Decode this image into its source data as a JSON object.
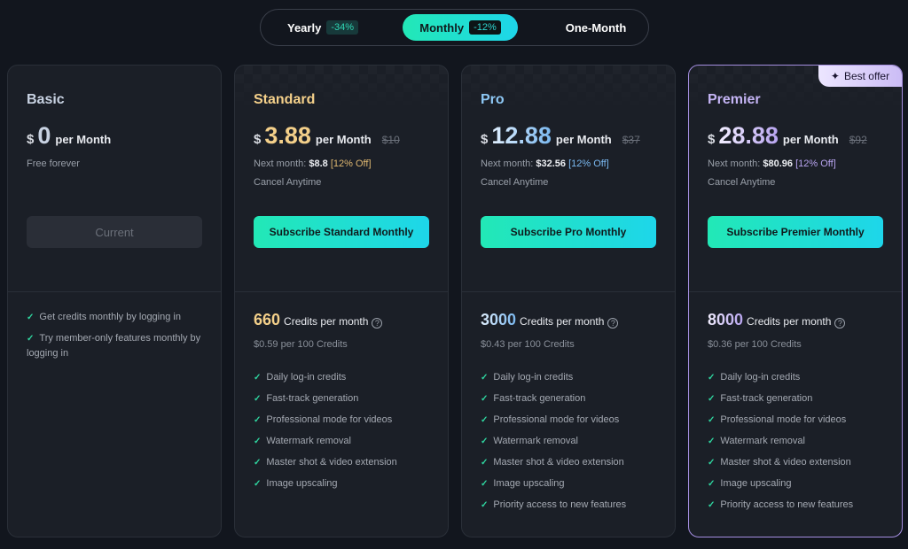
{
  "billing_toggle": {
    "options": [
      {
        "label": "Yearly",
        "badge": "-34%"
      },
      {
        "label": "Monthly",
        "badge": "-12%"
      },
      {
        "label": "One-Month",
        "badge": null
      }
    ],
    "selected": "Monthly"
  },
  "colors": {
    "accent_gradient_start": "#22e8b6",
    "accent_gradient_end": "#1ed6ea",
    "basic": "#c8d2e2",
    "standard": "#f4d08a",
    "pro": "#8ec8f5",
    "premier": "#c4b4f4"
  },
  "plans": [
    {
      "name": "Basic",
      "currency": "$",
      "amount": "0",
      "per": "per Month",
      "note": "Free forever",
      "button": "Current",
      "features": [
        "Get credits monthly by logging in",
        "Try member-only features monthly by logging in"
      ]
    },
    {
      "name": "Standard",
      "currency": "$",
      "amount": "3.88",
      "per": "per Month",
      "original": "$10",
      "next_label": "Next month:",
      "next_price": "$8.8",
      "next_discount": "[12% Off]",
      "cancel": "Cancel Anytime",
      "button": "Subscribe Standard Monthly",
      "credits": "660",
      "credits_label": "Credits per month",
      "per100": "$0.59 per 100 Credits",
      "features": [
        "Daily log-in credits",
        "Fast-track generation",
        "Professional mode for videos",
        "Watermark removal",
        "Master shot & video extension",
        "Image upscaling"
      ]
    },
    {
      "name": "Pro",
      "currency": "$",
      "amount": "12.88",
      "per": "per Month",
      "original": "$37",
      "next_label": "Next month:",
      "next_price": "$32.56",
      "next_discount": "[12% Off]",
      "cancel": "Cancel Anytime",
      "button": "Subscribe Pro Monthly",
      "credits": "3000",
      "credits_label": "Credits per month",
      "per100": "$0.43 per 100 Credits",
      "features": [
        "Daily log-in credits",
        "Fast-track generation",
        "Professional mode for videos",
        "Watermark removal",
        "Master shot & video extension",
        "Image upscaling",
        "Priority access to new features"
      ]
    },
    {
      "name": "Premier",
      "badge": "Best offer",
      "currency": "$",
      "amount": "28.88",
      "per": "per Month",
      "original": "$92",
      "next_label": "Next month:",
      "next_price": "$80.96",
      "next_discount": "[12% Off]",
      "cancel": "Cancel Anytime",
      "button": "Subscribe Premier Monthly",
      "credits": "8000",
      "credits_label": "Credits per month",
      "per100": "$0.36 per 100 Credits",
      "features": [
        "Daily log-in credits",
        "Fast-track generation",
        "Professional mode for videos",
        "Watermark removal",
        "Master shot & video extension",
        "Image upscaling",
        "Priority access to new features"
      ]
    }
  ],
  "icons": {
    "check": "✓",
    "help": "?",
    "sparkle": "✦"
  }
}
